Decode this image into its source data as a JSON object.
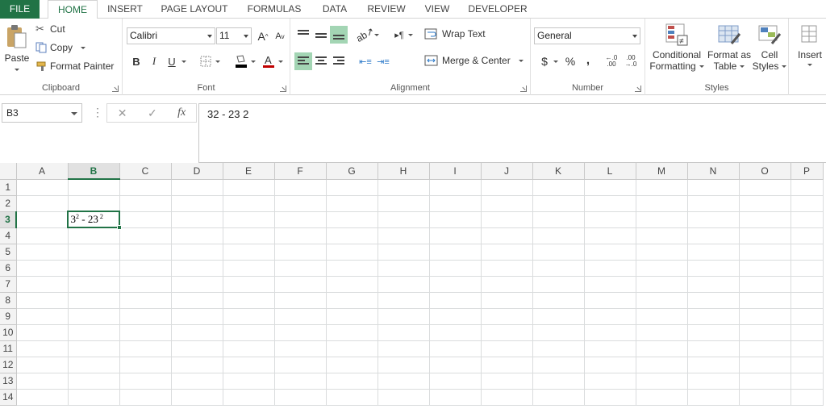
{
  "tabs": [
    {
      "label": "FILE"
    },
    {
      "label": "HOME"
    },
    {
      "label": "INSERT"
    },
    {
      "label": "PAGE LAYOUT"
    },
    {
      "label": "FORMULAS"
    },
    {
      "label": "DATA"
    },
    {
      "label": "REVIEW"
    },
    {
      "label": "VIEW"
    },
    {
      "label": "DEVELOPER"
    }
  ],
  "clipboard": {
    "paste": "Paste",
    "cut": "Cut",
    "copy": "Copy",
    "format_painter": "Format Painter",
    "label": "Clipboard"
  },
  "font": {
    "name": "Calibri",
    "size": "11",
    "bold": "B",
    "italic": "I",
    "underline": "U",
    "grow": "A",
    "shrink": "A",
    "label": "Font"
  },
  "alignment": {
    "wrap_text": "Wrap Text",
    "merge_center": "Merge & Center",
    "label": "Alignment"
  },
  "number": {
    "format": "General",
    "currency": "$",
    "percent": "%",
    "comma": ",",
    "inc_decimal": "←.0 .00",
    "dec_decimal": ".00 →.0",
    "label": "Number"
  },
  "styles": {
    "conditional_formatting_1": "Conditional",
    "conditional_formatting_2": "Formatting",
    "format_as_table_1": "Format as",
    "format_as_table_2": "Table",
    "cell_styles_1": "Cell",
    "cell_styles_2": "Styles",
    "label": "Styles"
  },
  "cells": {
    "insert": "Insert"
  },
  "formula_bar": {
    "name_box": "B3",
    "cancel": "✕",
    "enter": "✓",
    "fx": "fx",
    "content": "32  - 23 2"
  },
  "grid": {
    "columns": [
      "A",
      "B",
      "C",
      "D",
      "E",
      "F",
      "G",
      "H",
      "I",
      "J",
      "K",
      "L",
      "M",
      "N",
      "O",
      "P"
    ],
    "rows": [
      "1",
      "2",
      "3",
      "4",
      "5",
      "6",
      "7",
      "8",
      "9",
      "10",
      "11",
      "12",
      "13",
      "14"
    ],
    "selected_column": "B",
    "selected_row": "3",
    "b3": {
      "base1": "3",
      "sup1": "2",
      "middle": " - 23",
      "sup2": "2"
    }
  },
  "colors": {
    "accent": "#217346",
    "selected_button": "#a3d5b4"
  }
}
